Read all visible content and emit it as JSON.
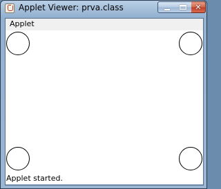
{
  "window": {
    "title": "Applet Viewer: prva.class",
    "app_icon": "java-coffee-cup-icon"
  },
  "caption_buttons": {
    "minimize_icon": "minimize-icon",
    "maximize_icon": "maximize-icon",
    "close_icon": "close-icon",
    "close_glyph": "✕"
  },
  "menu": {
    "items": [
      {
        "label": "Applet"
      }
    ]
  },
  "applet": {
    "circles": [
      "top-left",
      "top-right",
      "bottom-left",
      "bottom-right"
    ]
  },
  "status": {
    "text": "Applet started."
  },
  "colors": {
    "title_bar": "#a6c0db",
    "close_button": "#c0402a",
    "menu_bar": "#f0f0f0",
    "applet_background": "#ffffff",
    "circle_stroke": "#000000"
  }
}
